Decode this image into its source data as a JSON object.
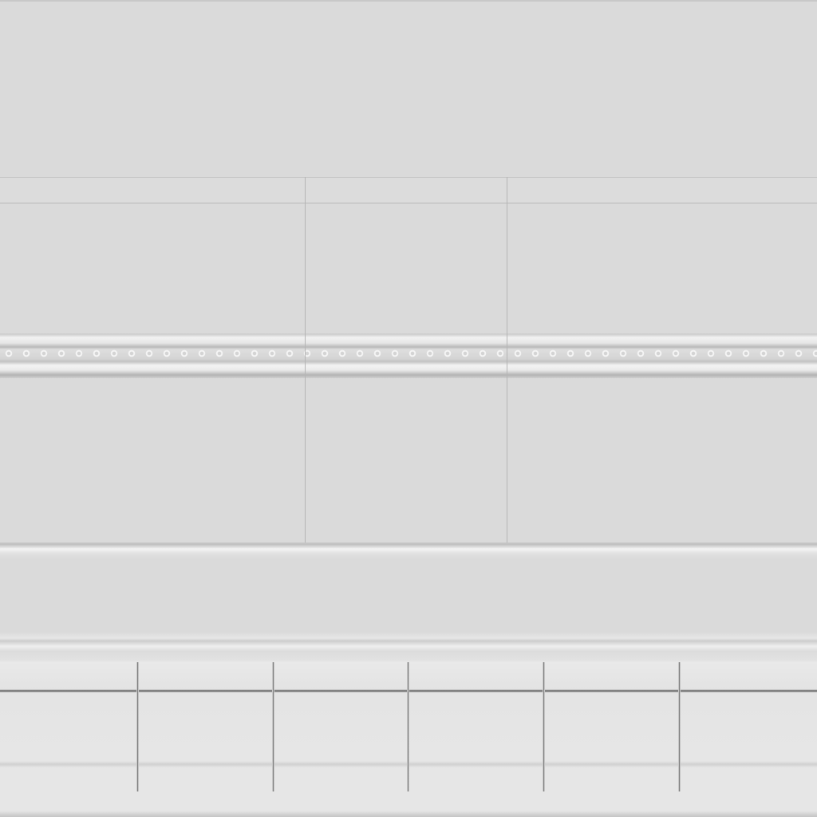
{
  "texture": {
    "colors": {
      "wall": "#dadada",
      "seam": "#b5b5b5",
      "highlight": "#f4f4f4",
      "shadow": "#6a6a6a"
    }
  }
}
